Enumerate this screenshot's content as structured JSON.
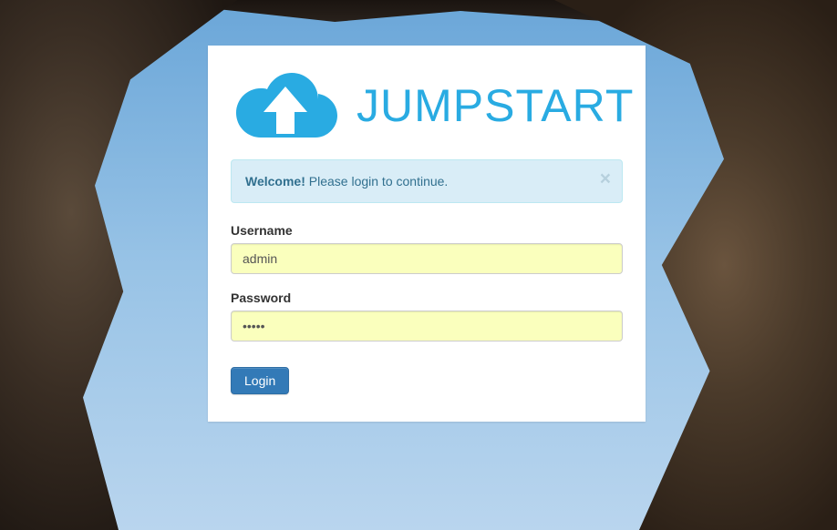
{
  "brand": {
    "name": "JUMPSTART"
  },
  "alert": {
    "strong": "Welcome!",
    "text": " Please login to continue.",
    "close_glyph": "×"
  },
  "form": {
    "username": {
      "label": "Username",
      "value": "admin",
      "placeholder": ""
    },
    "password": {
      "label": "Password",
      "value": "•••••",
      "placeholder": ""
    },
    "submit_label": "Login"
  },
  "colors": {
    "brand": "#29abe2",
    "btn_primary": "#337ab7",
    "alert_bg": "#d9edf7",
    "input_autofill": "#faffbd"
  }
}
